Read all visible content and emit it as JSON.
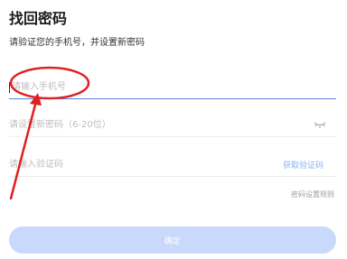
{
  "page": {
    "title": "找回密码",
    "subtitle": "请验证您的手机号，并设置新密码"
  },
  "form": {
    "phone_placeholder": "请输入手机号",
    "password_placeholder": "请设置新密码（6-20位）",
    "code_placeholder": "请输入验证码",
    "get_code_label": "获取验证码",
    "password_rules_link": "密码设置规则",
    "confirm_label": "确定"
  },
  "icons": {
    "password_toggle": "eye-closed-icon"
  },
  "colors": {
    "primary_disabled": "#c9d9fb",
    "link": "#8fb0ec",
    "annotation": "#e02020",
    "active_underline": "#5a83d6"
  }
}
